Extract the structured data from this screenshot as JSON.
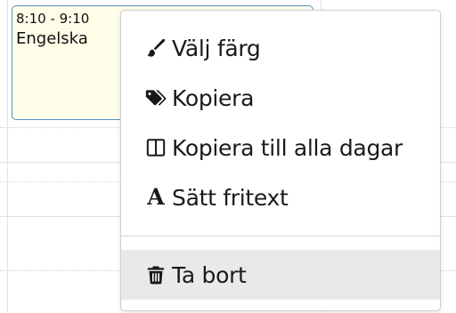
{
  "lesson": {
    "time": "8:10 - 9:10",
    "subject": "Engelska"
  },
  "context_menu": {
    "items": [
      {
        "label": "Välj färg",
        "icon": "paintbrush-icon"
      },
      {
        "label": "Kopiera",
        "icon": "tags-icon"
      },
      {
        "label": "Kopiera till alla dagar",
        "icon": "columns-icon"
      },
      {
        "label": "Sätt fritext",
        "icon": "font-icon",
        "glyph": "A"
      },
      {
        "label": "Ta bort",
        "icon": "trash-icon",
        "highlighted": true
      }
    ]
  },
  "colors": {
    "lesson_background": "#fefde8",
    "lesson_border": "#5b8fc4",
    "menu_hover": "#e9e9ec"
  }
}
